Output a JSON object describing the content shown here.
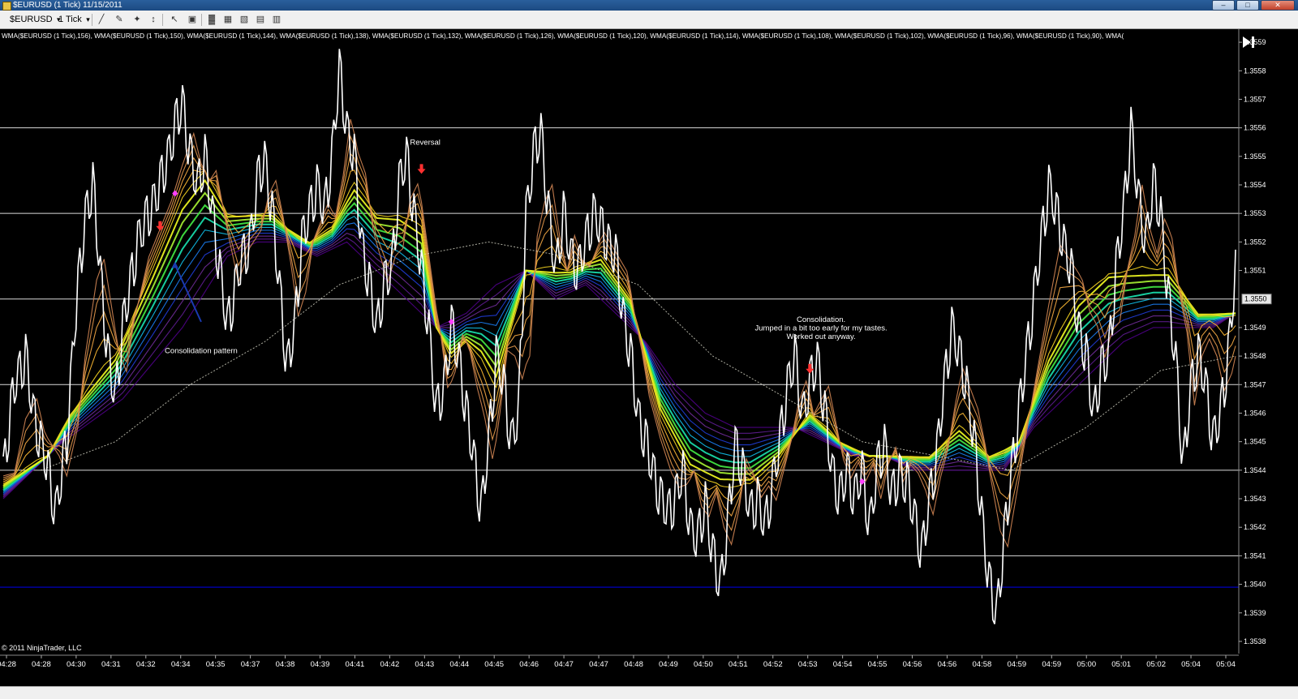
{
  "window": {
    "title": "$EURUSD (1 Tick)  11/15/2011",
    "buttons": [
      "–",
      "□",
      "✕"
    ]
  },
  "toolbar": {
    "instrument": "$EURUSD",
    "interval": "1 Tick",
    "icons": [
      "line-chart-icon",
      "pencil-icon",
      "pin-icon",
      "ruler-icon",
      "cursor-icon",
      "crosshair-icon",
      "bars-icon",
      "calendar-icon",
      "image-icon",
      "strategy-icon",
      "table-icon"
    ]
  },
  "chart_data": {
    "type": "line",
    "indicator_header": "WMA($EURUSD (1 Tick),156), WMA($EURUSD (1 Tick),150), WMA($EURUSD (1 Tick),144), WMA($EURUSD (1 Tick),138), WMA($EURUSD (1 Tick),132), WMA($EURUSD (1 Tick),126), WMA($EURUSD (1 Tick),120), WMA($EURUSD (1 Tick),114), WMA($EURUSD (1 Tick),108), WMA($EURUSD (1 Tick),102), WMA($EURUSD (1 Tick),96), WMA($EURUSD (1 Tick),90), WMA(",
    "copyright": "© 2011 NinjaTrader, LLC",
    "y_ticks": [
      "1.3559",
      "1.3558",
      "1.3557",
      "1.3556",
      "1.3555",
      "1.3554",
      "1.3553",
      "1.3552",
      "1.3551",
      "1.3549",
      "1.3548",
      "1.3547",
      "1.3546",
      "1.3545",
      "1.3544",
      "1.3543",
      "1.3542",
      "1.3541",
      "1.3540",
      "1.3539",
      "1.3538"
    ],
    "y_tick_values": [
      1.3559,
      1.3558,
      1.3557,
      1.3556,
      1.3555,
      1.3554,
      1.3553,
      1.3552,
      1.3551,
      1.3549,
      1.3548,
      1.3547,
      1.3546,
      1.3545,
      1.3544,
      1.3543,
      1.3542,
      1.3541,
      1.354,
      1.3539,
      1.3538
    ],
    "last_price": "1.3550",
    "last_price_value": 1.355,
    "ylim": [
      1.35378,
      1.35594
    ],
    "horizontal_lines": [
      1.3556,
      1.3553,
      1.355,
      1.3547,
      1.3544,
      1.3541
    ],
    "blue_line": 1.35399,
    "x_ticks": [
      "04:28",
      "04:28",
      "04:30",
      "04:31",
      "04:32",
      "04:34",
      "04:35",
      "04:37",
      "04:38",
      "04:39",
      "04:41",
      "04:42",
      "04:43",
      "04:44",
      "04:45",
      "04:46",
      "04:47",
      "04:47",
      "04:48",
      "04:49",
      "04:50",
      "04:51",
      "04:52",
      "04:53",
      "04:54",
      "04:55",
      "04:56",
      "04:56",
      "04:58",
      "04:59",
      "04:59",
      "05:00",
      "05:01",
      "05:02",
      "05:04",
      "05:04"
    ],
    "price_path": [
      [
        0,
        1.3544
      ],
      [
        1.5,
        1.3547
      ],
      [
        3,
        1.3548
      ],
      [
        4,
        1.3546
      ],
      [
        6,
        1.3544
      ],
      [
        7,
        1.35425
      ],
      [
        8.5,
        1.3545
      ],
      [
        9.5,
        1.3549
      ],
      [
        11,
        1.3553
      ],
      [
        12,
        1.3554
      ],
      [
        13,
        1.3551
      ],
      [
        14,
        1.3548
      ],
      [
        15,
        1.35465
      ],
      [
        16,
        1.3549
      ],
      [
        18,
        1.3552
      ],
      [
        19.5,
        1.3553
      ],
      [
        21,
        1.3554
      ],
      [
        22,
        1.3555
      ],
      [
        23,
        1.3556
      ],
      [
        24,
        1.3557
      ],
      [
        25,
        1.3555
      ],
      [
        26,
        1.3554
      ],
      [
        27,
        1.3555
      ],
      [
        28,
        1.3553
      ],
      [
        29,
        1.3551
      ],
      [
        30,
        1.3549
      ],
      [
        31.5,
        1.3551
      ],
      [
        33,
        1.3552
      ],
      [
        34,
        1.3554
      ],
      [
        35,
        1.3555
      ],
      [
        36,
        1.3553
      ],
      [
        37,
        1.35505
      ],
      [
        38,
        1.35475
      ],
      [
        39,
        1.3549
      ],
      [
        40,
        1.3552
      ],
      [
        41,
        1.3553
      ],
      [
        42,
        1.3554
      ],
      [
        43,
        1.3553
      ],
      [
        44,
        1.3555
      ],
      [
        45,
        1.3558
      ],
      [
        46,
        1.3556
      ],
      [
        47,
        1.3555
      ],
      [
        48,
        1.3552
      ],
      [
        49,
        1.35505
      ],
      [
        50,
        1.3549
      ],
      [
        51,
        1.35505
      ],
      [
        52,
        1.3551
      ],
      [
        53,
        1.3554
      ],
      [
        54,
        1.3555
      ],
      [
        55,
        1.3553
      ],
      [
        56,
        1.3551
      ],
      [
        57,
        1.3549
      ],
      [
        58,
        1.3546
      ],
      [
        59,
        1.3547
      ],
      [
        60,
        1.3549
      ],
      [
        61,
        1.3548
      ],
      [
        62,
        1.3546
      ],
      [
        63,
        1.35445
      ],
      [
        64,
        1.35425
      ],
      [
        65,
        1.3545
      ],
      [
        66,
        1.3548
      ],
      [
        67,
        1.3547
      ],
      [
        68,
        1.3545
      ],
      [
        69,
        1.3546
      ],
      [
        70,
        1.3553
      ],
      [
        71,
        1.3555
      ],
      [
        72,
        1.3556
      ],
      [
        73,
        1.3553
      ],
      [
        74,
        1.3551
      ],
      [
        75,
        1.3553
      ],
      [
        76,
        1.35515
      ],
      [
        77,
        1.3551
      ],
      [
        78,
        1.3552
      ],
      [
        79,
        1.3553
      ],
      [
        80,
        1.35525
      ],
      [
        81,
        1.3552
      ],
      [
        82,
        1.35515
      ],
      [
        83,
        1.35495
      ],
      [
        84,
        1.3548
      ],
      [
        85,
        1.3546
      ],
      [
        86,
        1.3545
      ],
      [
        87,
        1.3544
      ],
      [
        88,
        1.3543
      ],
      [
        89,
        1.35425
      ],
      [
        90,
        1.3543
      ],
      [
        91,
        1.3544
      ],
      [
        92,
        1.3542
      ],
      [
        93,
        1.35415
      ],
      [
        94,
        1.3543
      ],
      [
        95,
        1.3541
      ],
      [
        96,
        1.354
      ],
      [
        97,
        1.3542
      ],
      [
        98,
        1.3545
      ],
      [
        99,
        1.3544
      ],
      [
        100,
        1.35425
      ],
      [
        101,
        1.3543
      ],
      [
        102,
        1.3542
      ],
      [
        103,
        1.35435
      ],
      [
        104,
        1.3545
      ],
      [
        105,
        1.3547
      ],
      [
        106,
        1.3548
      ],
      [
        107,
        1.3546
      ],
      [
        108,
        1.3547
      ],
      [
        109,
        1.3548
      ],
      [
        110,
        1.3546
      ],
      [
        111,
        1.3544
      ],
      [
        112,
        1.3543
      ],
      [
        113,
        1.3544
      ],
      [
        114,
        1.3543
      ],
      [
        115,
        1.3544
      ],
      [
        116,
        1.3542
      ],
      [
        117,
        1.3544
      ],
      [
        118,
        1.3545
      ],
      [
        119,
        1.3543
      ],
      [
        120,
        1.3544
      ],
      [
        121,
        1.35435
      ],
      [
        122,
        1.35425
      ],
      [
        123,
        1.3541
      ],
      [
        124,
        1.3543
      ],
      [
        125,
        1.35445
      ],
      [
        126,
        1.3547
      ],
      [
        127,
        1.3549
      ],
      [
        128,
        1.3548
      ],
      [
        129,
        1.3547
      ],
      [
        130,
        1.3545
      ],
      [
        131,
        1.35425
      ],
      [
        132,
        1.354
      ],
      [
        133,
        1.3539
      ],
      [
        134,
        1.35415
      ],
      [
        135,
        1.3544
      ],
      [
        136,
        1.3546
      ],
      [
        137,
        1.3548
      ],
      [
        138,
        1.355
      ],
      [
        139,
        1.3552
      ],
      [
        140,
        1.3554
      ],
      [
        141,
        1.3553
      ],
      [
        142,
        1.3552
      ],
      [
        143,
        1.3551
      ],
      [
        144,
        1.3549
      ],
      [
        145,
        1.3548
      ],
      [
        146,
        1.3546
      ],
      [
        147,
        1.35475
      ],
      [
        148,
        1.3548
      ],
      [
        149,
        1.3551
      ],
      [
        150,
        1.3553
      ],
      [
        151,
        1.3556
      ],
      [
        152,
        1.35535
      ],
      [
        153,
        1.3552
      ],
      [
        154,
        1.3554
      ],
      [
        155,
        1.3553
      ],
      [
        156,
        1.355
      ],
      [
        157,
        1.3548
      ],
      [
        158,
        1.3544
      ],
      [
        159,
        1.3547
      ],
      [
        160,
        1.3548
      ],
      [
        161,
        1.3547
      ],
      [
        162,
        1.3545
      ],
      [
        163,
        1.3546
      ],
      [
        164,
        1.3548
      ],
      [
        165,
        1.3551
      ]
    ],
    "series": [
      {
        "path": [
          [
            0,
            1.35435
          ],
          [
            6,
            1.35445
          ],
          [
            9,
            1.3546
          ],
          [
            15,
            1.3548
          ],
          [
            20,
            1.3551
          ],
          [
            24,
            1.35535
          ],
          [
            27,
            1.35545
          ],
          [
            30,
            1.3553
          ],
          [
            33,
            1.3553
          ],
          [
            36,
            1.3553
          ],
          [
            38,
            1.35525
          ],
          [
            41,
            1.3552
          ],
          [
            44,
            1.35525
          ],
          [
            47,
            1.3554
          ],
          [
            50,
            1.3553
          ],
          [
            53,
            1.3553
          ],
          [
            56,
            1.35525
          ],
          [
            58,
            1.3549
          ],
          [
            60,
            1.3548
          ],
          [
            62,
            1.35485
          ],
          [
            64,
            1.3548
          ],
          [
            66,
            1.3547
          ],
          [
            68,
            1.3549
          ],
          [
            70,
            1.3551
          ],
          [
            72,
            1.3551
          ],
          [
            76,
            1.3551
          ],
          [
            80,
            1.35515
          ],
          [
            84,
            1.355
          ],
          [
            88,
            1.3546
          ],
          [
            92,
            1.3544
          ],
          [
            96,
            1.35435
          ],
          [
            100,
            1.35435
          ],
          [
            104,
            1.35445
          ],
          [
            108,
            1.3546
          ],
          [
            112,
            1.3545
          ],
          [
            116,
            1.35445
          ],
          [
            120,
            1.35445
          ],
          [
            124,
            1.35445
          ],
          [
            128,
            1.35455
          ],
          [
            132,
            1.35445
          ],
          [
            136,
            1.3545
          ],
          [
            140,
            1.3548
          ],
          [
            144,
            1.355
          ],
          [
            148,
            1.3551
          ],
          [
            152,
            1.3551
          ],
          [
            156,
            1.3551
          ],
          [
            160,
            1.35495
          ],
          [
            165,
            1.35495
          ]
        ]
      },
      {
        "path": [
          [
            0,
            1.3543
          ],
          [
            8,
            1.3545
          ],
          [
            16,
            1.35465
          ],
          [
            24,
            1.3549
          ],
          [
            30,
            1.35515
          ],
          [
            34,
            1.3552
          ],
          [
            38,
            1.3552
          ],
          [
            42,
            1.35515
          ],
          [
            46,
            1.3552
          ],
          [
            50,
            1.3551
          ],
          [
            54,
            1.355
          ],
          [
            58,
            1.3549
          ],
          [
            62,
            1.35495
          ],
          [
            66,
            1.35505
          ],
          [
            70,
            1.3551
          ],
          [
            74,
            1.355
          ],
          [
            78,
            1.35505
          ],
          [
            82,
            1.35495
          ],
          [
            86,
            1.35485
          ],
          [
            90,
            1.3547
          ],
          [
            94,
            1.3546
          ],
          [
            98,
            1.35455
          ],
          [
            102,
            1.35455
          ],
          [
            106,
            1.35455
          ],
          [
            110,
            1.3545
          ],
          [
            114,
            1.35445
          ],
          [
            118,
            1.35445
          ],
          [
            122,
            1.3544
          ],
          [
            126,
            1.3544
          ],
          [
            130,
            1.3544
          ],
          [
            134,
            1.3544
          ],
          [
            138,
            1.35455
          ],
          [
            142,
            1.35465
          ],
          [
            146,
            1.35475
          ],
          [
            150,
            1.35485
          ],
          [
            154,
            1.3549
          ],
          [
            158,
            1.3549
          ],
          [
            162,
            1.3549
          ],
          [
            165,
            1.35495
          ]
        ]
      }
    ],
    "markers": [
      {
        "type": "arrow-down",
        "x": 21,
        "y": 1.35525,
        "color": "#ff3030"
      },
      {
        "type": "arrow-down",
        "x": 56,
        "y": 1.35545,
        "color": "#ff3030"
      },
      {
        "type": "arrow-down",
        "x": 108,
        "y": 1.35475,
        "color": "#ff3030"
      },
      {
        "type": "dot",
        "x": 23,
        "y": 1.35537,
        "color": "#ff40ff"
      },
      {
        "type": "dot",
        "x": 60,
        "y": 1.35492,
        "color": "#ff40ff"
      },
      {
        "type": "dot",
        "x": 115,
        "y": 1.35436,
        "color": "#ff40ff"
      }
    ],
    "annotations": [
      {
        "text": "Reversal",
        "x": 56.5,
        "y": 1.35554
      },
      {
        "text": "Consolidation pattern",
        "x": 26.5,
        "y": 1.35481
      },
      {
        "text": "Consolidation.",
        "x": 109.5,
        "y": 1.35492
      },
      {
        "text": "Jumped in a bit too early for my tastes.",
        "x": 109.5,
        "y": 1.35489
      },
      {
        "text": "Worked out anyway.",
        "x": 109.5,
        "y": 1.35486
      }
    ],
    "trendline": [
      [
        23,
        1.35512
      ],
      [
        26.5,
        1.35492
      ]
    ],
    "ribbon_colors": [
      "#4b0082",
      "#5a1a8a",
      "#6a2a92",
      "#1f3ad0",
      "#1878e8",
      "#10b8e0",
      "#18d8a8",
      "#40e040",
      "#a0e830",
      "#e8f020",
      "#f0d020",
      "#f0b030",
      "#e8a040",
      "#d89048",
      "#c88050"
    ]
  },
  "colors": {
    "background": "#000000",
    "price": "#ffffff",
    "gridline": "#ffffff",
    "blue_line": "#0000a0",
    "sma": "#d8d8c8"
  }
}
